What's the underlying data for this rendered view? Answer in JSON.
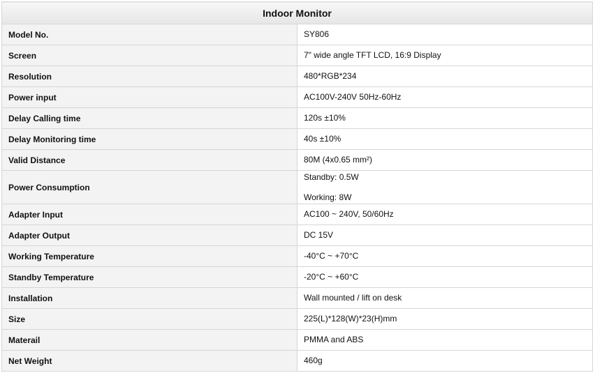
{
  "table": {
    "title": "Indoor Monitor",
    "rows": [
      {
        "label": "Model No.",
        "value": [
          "SY806"
        ]
      },
      {
        "label": "Screen",
        "value": [
          "7\" wide angle TFT LCD, 16:9 Display"
        ]
      },
      {
        "label": "Resolution",
        "value": [
          "480*RGB*234"
        ]
      },
      {
        "label": "Power input",
        "value": [
          "AC100V-240V 50Hz-60Hz"
        ]
      },
      {
        "label": "Delay Calling time",
        "value": [
          "120s ±10%"
        ]
      },
      {
        "label": "Delay Monitoring time",
        "value": [
          "40s ±10%"
        ]
      },
      {
        "label": "Valid Distance",
        "value": [
          "80M (4x0.65 mm²)"
        ]
      },
      {
        "label": "Power Consumption",
        "value": [
          "Standby: 0.5W",
          "Working: 8W"
        ]
      },
      {
        "label": "Adapter Input",
        "value": [
          "AC100 ~ 240V, 50/60Hz"
        ]
      },
      {
        "label": "Adapter Output",
        "value": [
          "DC 15V"
        ]
      },
      {
        "label": "Working Temperature",
        "value": [
          "-40°C ~ +70°C"
        ]
      },
      {
        "label": "Standby Temperature",
        "value": [
          "-20°C ~ +60°C"
        ]
      },
      {
        "label": "Installation",
        "value": [
          "Wall mounted / lift on desk"
        ]
      },
      {
        "label": "Size",
        "value": [
          "225(L)*128(W)*23(H)mm"
        ]
      },
      {
        "label": "Materail",
        "value": [
          "PMMA and ABS"
        ]
      },
      {
        "label": "Net Weight",
        "value": [
          "460g"
        ]
      }
    ]
  }
}
